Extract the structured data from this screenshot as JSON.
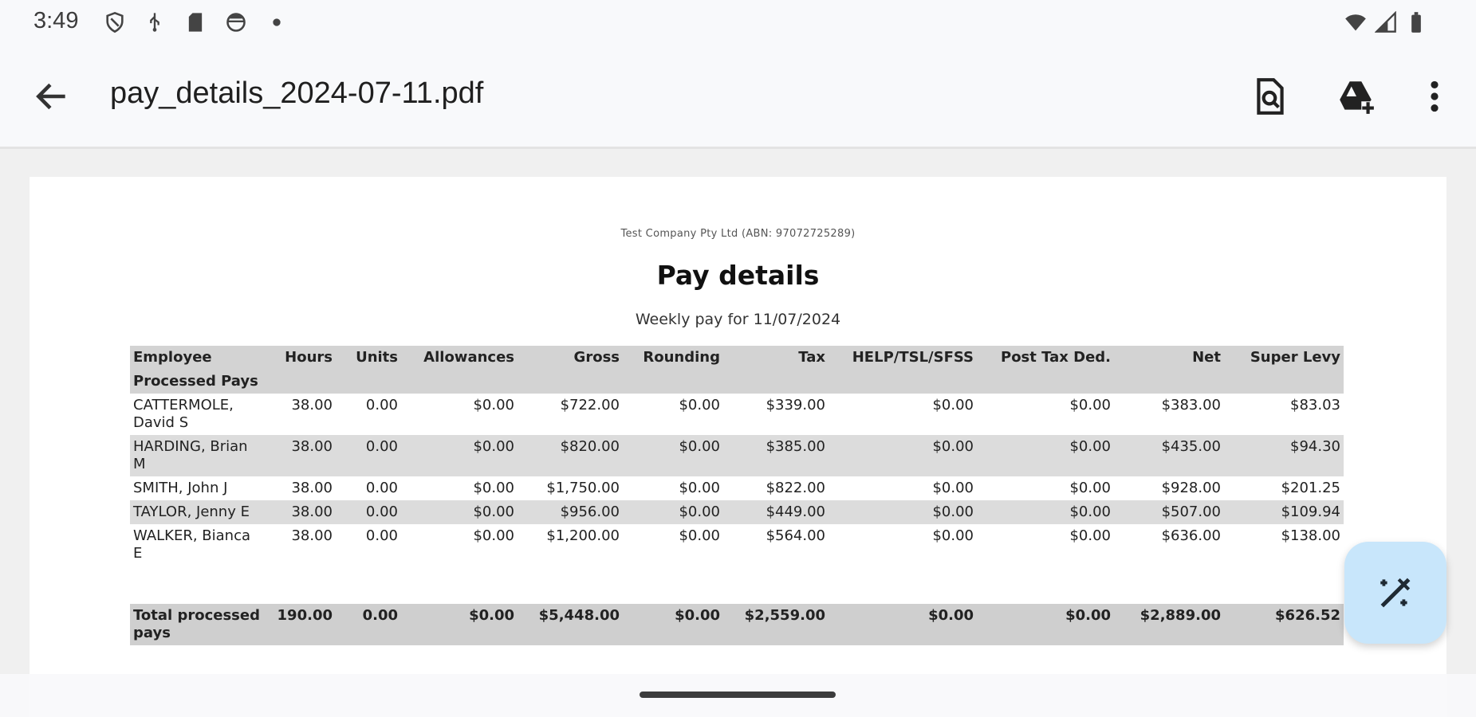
{
  "status_bar": {
    "time": "3:49",
    "left_icons": [
      "shield-icon",
      "usb-icon",
      "sd-card-icon",
      "cast-icon",
      "dot-icon"
    ],
    "right_icons": [
      "wifi-icon",
      "signal-icon",
      "battery-icon"
    ]
  },
  "app_bar": {
    "back_icon": "arrow-back-icon",
    "title": "pay_details_2024-07-11.pdf",
    "actions": [
      "search-document-icon",
      "drive-add-icon",
      "more-vert-icon"
    ]
  },
  "document": {
    "company": "Test Company Pty Ltd (ABN: 97072725289)",
    "title": "Pay details",
    "subtitle": "Weekly pay for 11/07/2024",
    "table": {
      "headers": [
        "Employee",
        "Hours",
        "Units",
        "Allowances",
        "Gross",
        "Rounding",
        "Tax",
        "HELP/TSL/SFSS",
        "Post Tax Ded.",
        "Net",
        "Super Levy"
      ],
      "section_label": "Processed Pays",
      "rows": [
        {
          "name": "CATTERMOLE, David S",
          "hours": "38.00",
          "units": "0.00",
          "allowances": "$0.00",
          "gross": "$722.00",
          "rounding": "$0.00",
          "tax": "$339.00",
          "help": "$0.00",
          "post_tax": "$0.00",
          "net": "$383.00",
          "super": "$83.03"
        },
        {
          "name": "HARDING, Brian M",
          "hours": "38.00",
          "units": "0.00",
          "allowances": "$0.00",
          "gross": "$820.00",
          "rounding": "$0.00",
          "tax": "$385.00",
          "help": "$0.00",
          "post_tax": "$0.00",
          "net": "$435.00",
          "super": "$94.30"
        },
        {
          "name": "SMITH, John J",
          "hours": "38.00",
          "units": "0.00",
          "allowances": "$0.00",
          "gross": "$1,750.00",
          "rounding": "$0.00",
          "tax": "$822.00",
          "help": "$0.00",
          "post_tax": "$0.00",
          "net": "$928.00",
          "super": "$201.25"
        },
        {
          "name": "TAYLOR, Jenny E",
          "hours": "38.00",
          "units": "0.00",
          "allowances": "$0.00",
          "gross": "$956.00",
          "rounding": "$0.00",
          "tax": "$449.00",
          "help": "$0.00",
          "post_tax": "$0.00",
          "net": "$507.00",
          "super": "$109.94"
        },
        {
          "name": "WALKER, Bianca E",
          "hours": "38.00",
          "units": "0.00",
          "allowances": "$0.00",
          "gross": "$1,200.00",
          "rounding": "$0.00",
          "tax": "$564.00",
          "help": "$0.00",
          "post_tax": "$0.00",
          "net": "$636.00",
          "super": "$138.00"
        }
      ],
      "total": {
        "name": "Total processed pays",
        "hours": "190.00",
        "units": "0.00",
        "allowances": "$0.00",
        "gross": "$5,448.00",
        "rounding": "$0.00",
        "tax": "$2,559.00",
        "help": "$0.00",
        "post_tax": "$0.00",
        "net": "$2,889.00",
        "super": "$626.52"
      }
    }
  },
  "fab": {
    "icon": "edit-magic-icon"
  },
  "colors": {
    "fab_bg": "#c8e6fb",
    "header_row": "#d3d3d3",
    "shade_row": "#dcdcdc"
  }
}
